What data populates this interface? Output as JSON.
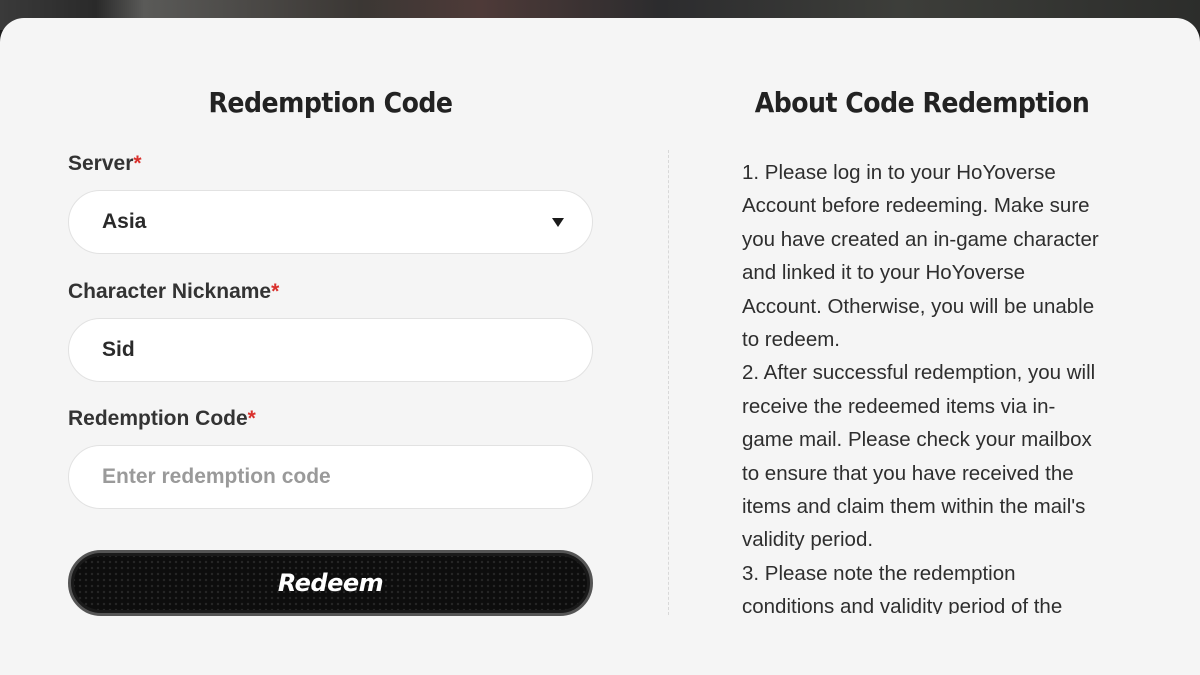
{
  "form": {
    "title": "Redemption Code",
    "server_label": "Server",
    "server_value": "Asia",
    "nickname_label": "Character Nickname",
    "nickname_value": "Sid",
    "code_label": "Redemption Code",
    "code_placeholder": "Enter redemption code",
    "required_mark": "*",
    "redeem_label": "Redeem"
  },
  "about": {
    "title": "About Code Redemption",
    "paragraphs": [
      "1. Please log in to your HoYoverse Account before redeeming. Make sure you have created an in-game character and linked it to your HoYoverse Account. Otherwise, you will be unable to redeem.",
      "2. After successful redemption, you will receive the redeemed items via in-game mail. Please check your mailbox to ensure that you have received the items and claim them within the mail's validity period.",
      "3. Please note the redemption conditions and validity period of the"
    ]
  },
  "colors": {
    "required": "#d9302c",
    "panel_bg": "#f5f5f5",
    "button_bg": "#0d0d0d"
  },
  "icons": {
    "server_dropdown": "caret-down-icon"
  }
}
